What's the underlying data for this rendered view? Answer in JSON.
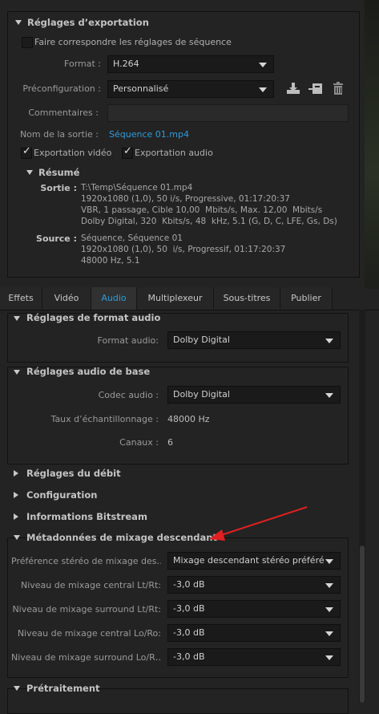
{
  "export_settings": {
    "title": "Réglages d’exportation",
    "match_sequence_label": "Faire correspondre les réglages de séquence",
    "format_label": "Format :",
    "format_value": "H.264",
    "preset_label": "Préconfiguration :",
    "preset_value": "Personnalisé",
    "comments_label": "Commentaires :",
    "comments_value": "",
    "output_label": "Nom de la sortie :",
    "output_value": "Séquence 01.mp4",
    "export_video_label": "Exportation vidéo",
    "export_audio_label": "Exportation audio",
    "summary": {
      "title": "Résumé",
      "output_key": "Sortie :",
      "output_lines": [
        "T:\\Temp\\Séquence 01.mp4",
        "1920x1080 (1,0), 50 i/s, Progressive, 01:17:20:37",
        "VBR, 1 passage, Cible 10,00  Mbits/s, Max. 12,00  Mbits/s",
        "Dolby Digital, 320  Kbits/s, 48  kHz, 5.1 (G, D, C, LFE, Gs, Ds)"
      ],
      "source_key": "Source :",
      "source_lines": [
        "Séquence, Séquence 01",
        "1920x1080 (1,0), 50  i/s, Progressif, 01:17:20:37",
        "48000 Hz, 5.1"
      ]
    }
  },
  "tabs": [
    {
      "label": "Effets"
    },
    {
      "label": "Vidéo"
    },
    {
      "label": "Audio"
    },
    {
      "label": "Multiplexeur"
    },
    {
      "label": "Sous-titres"
    },
    {
      "label": "Publier"
    }
  ],
  "audio": {
    "format_section": {
      "title": "Réglages de format audio",
      "format_label": "Format audio:",
      "format_value": "Dolby Digital"
    },
    "basic_section": {
      "title": "Réglages audio de base",
      "codec_label": "Codec audio :",
      "codec_value": "Dolby Digital",
      "sample_rate_label": "Taux d’échantillonnage :",
      "sample_rate_value": "48000 Hz",
      "channels_label": "Canaux :",
      "channels_value": "6"
    },
    "bitrate_title": "Réglages du débit",
    "config_title": "Configuration",
    "bitstream_title": "Informations Bitstream",
    "downmix_section": {
      "title": "Métadonnées de mixage descendant",
      "rows": [
        {
          "label": "Préférence stéréo de mixage des…",
          "value": "Mixage descendant stéréo préféré"
        },
        {
          "label": "Niveau de mixage central Lt/Rt:",
          "value": "-3,0 dB"
        },
        {
          "label": "Niveau de mixage surround Lt/Rt:",
          "value": "-3,0 dB"
        },
        {
          "label": "Niveau de mixage central Lo/Ro:",
          "value": "-3,0 dB"
        },
        {
          "label": "Niveau de mixage surround Lo/R…",
          "value": "-3,0 dB"
        }
      ]
    },
    "preprocessing_title": "Prétraitement"
  },
  "colors": {
    "accent_blue": "#2d9cdb",
    "annotation_red": "#e02020"
  }
}
